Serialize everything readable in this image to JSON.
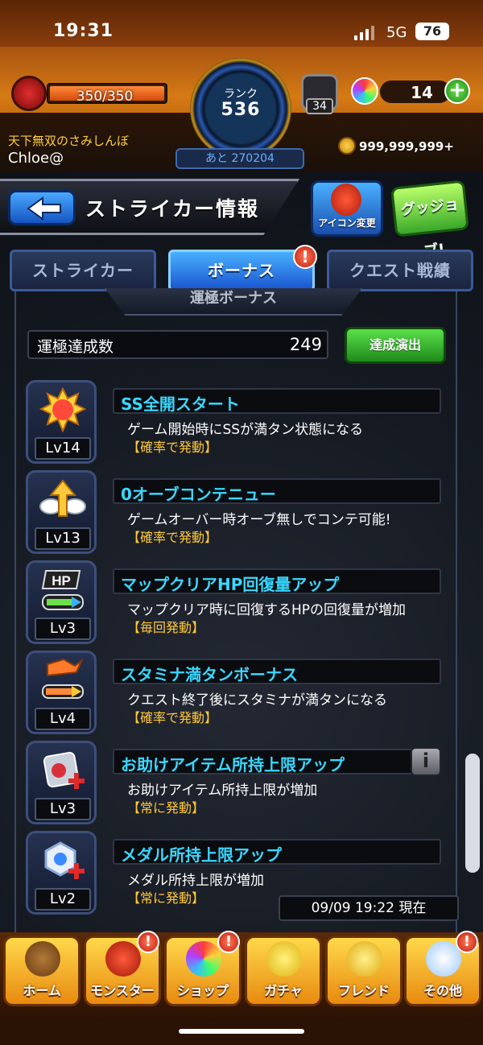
{
  "status_bar": {
    "time": "19:31",
    "network": "5G",
    "battery": "76"
  },
  "hud": {
    "stamina": "350/350",
    "rank_label": "ランク",
    "rank_value": "536",
    "exp_remaining": "あと 270204",
    "orb_item_count": "34",
    "orb_count": "14",
    "player_title": "天下無双のさみしんぼ",
    "player_name": "Chloe@",
    "coins": "999,999,999+"
  },
  "header": {
    "title": "ストライカー情報",
    "icon_change_label": "アイコン変更",
    "good_job_label": "グッジョブ!"
  },
  "tabs": [
    {
      "label": "ストライカー",
      "active": false
    },
    {
      "label": "ボーナス",
      "active": true,
      "badge": "!"
    },
    {
      "label": "クエスト戦績",
      "active": false
    }
  ],
  "section": {
    "title": "運極ボーナス",
    "count_label": "運極達成数",
    "count_value": "249",
    "perform_button": "達成演出"
  },
  "bonuses": [
    {
      "level": "Lv14",
      "name": "SS全開スタート",
      "description": "ゲーム開始時にSSが満タン状態になる",
      "trigger": "【確率で発動】",
      "icon": "go-burst-icon"
    },
    {
      "level": "Lv13",
      "name": "0オーブコンテニュー",
      "description": "ゲームオーバー時オーブ無しでコンテ可能!",
      "trigger": "【確率で発動】",
      "icon": "winged-arrow-icon"
    },
    {
      "level": "Lv3",
      "name": "マップクリアHP回復量アップ",
      "description": "マップクリア時に回復するHPの回復量が増加",
      "trigger": "【毎回発動】",
      "icon": "hp-up-icon"
    },
    {
      "level": "Lv4",
      "name": "スタミナ満タンボーナス",
      "description": "クエスト終了後にスタミナが満タンになる",
      "trigger": "【確率で発動】",
      "icon": "stamina-icon"
    },
    {
      "level": "Lv3",
      "name": "お助けアイテム所持上限アップ",
      "description": "お助けアイテム所持上限が増加",
      "trigger": "【常に発動】",
      "icon": "item-plus-icon"
    },
    {
      "level": "Lv2",
      "name": "メダル所持上限アップ",
      "description": "メダル所持上限が増加",
      "trigger": "【常に発動】",
      "icon": "medal-plus-icon"
    }
  ],
  "info_button": "i",
  "timestamp": "09/09 19:22 現在",
  "nav": [
    {
      "label": "ホーム",
      "badge": ""
    },
    {
      "label": "モンスター",
      "badge": "!"
    },
    {
      "label": "ショップ",
      "badge": "!"
    },
    {
      "label": "ガチャ",
      "badge": ""
    },
    {
      "label": "フレンド",
      "badge": ""
    },
    {
      "label": "その他",
      "badge": "!"
    }
  ]
}
